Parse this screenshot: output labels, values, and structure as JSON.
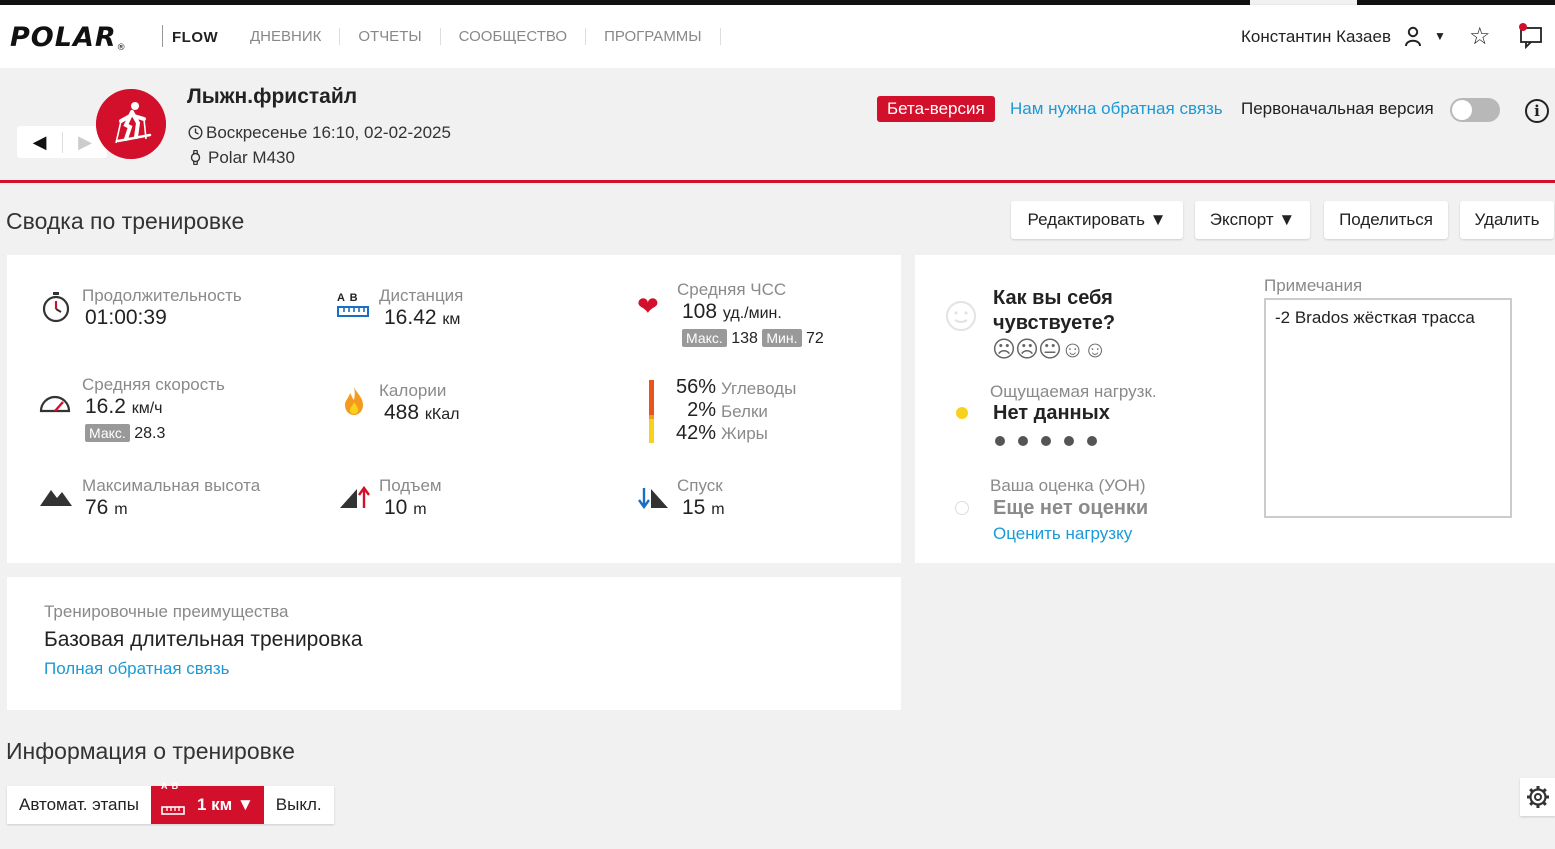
{
  "brand": {
    "logo": "POLAR",
    "logo_mark": "®",
    "product": "FLOW"
  },
  "nav": {
    "items": [
      "ДНЕВНИК",
      "ОТЧЕТЫ",
      "СООБЩЕСТВО",
      "ПРОГРАММЫ"
    ]
  },
  "user": {
    "name": "Константин Казаев"
  },
  "activity": {
    "title": "Лыжн.фристайл",
    "datetime": "Воскресенье 16:10, 02-02-2025",
    "device": "Polar M430"
  },
  "beta": {
    "badge": "Бета-версия",
    "feedback_link": "Нам нужна обратная связь",
    "original_label": "Первоначальная версия"
  },
  "summary": {
    "title": "Сводка по тренировке",
    "buttons": {
      "edit": "Редактировать ▼",
      "export": "Экспорт ▼",
      "share": "Поделиться",
      "delete": "Удалить"
    }
  },
  "stats": {
    "duration": {
      "label": "Продолжительность",
      "value": "01:00:39"
    },
    "distance": {
      "label": "Дистанция",
      "value": "16.42",
      "unit": "км",
      "icon_text": "A  B"
    },
    "avg_hr": {
      "label": "Средняя ЧСС",
      "value": "108",
      "unit": "уд./мин.",
      "max_label": "Макс.",
      "max": "138",
      "min_label": "Мин.",
      "min": "72"
    },
    "avg_speed": {
      "label": "Средняя скорость",
      "value": "16.2",
      "unit": "км/ч",
      "max_label": "Макс.",
      "max": "28.3"
    },
    "calories": {
      "label": "Калории",
      "value": "488",
      "unit": "кКал"
    },
    "macros": [
      {
        "pct": "56%",
        "name": "Углеводы",
        "color": "#e8541c"
      },
      {
        "pct": "2%",
        "name": "Белки",
        "color": "#f39a1f"
      },
      {
        "pct": "42%",
        "name": "Жиры",
        "color": "#f7d21c"
      }
    ],
    "max_alt": {
      "label": "Максимальная высота",
      "value": "76",
      "unit": "m"
    },
    "ascent": {
      "label": "Подъем",
      "value": "10",
      "unit": "m"
    },
    "descent": {
      "label": "Спуск",
      "value": "15",
      "unit": "m"
    }
  },
  "feeling": {
    "question_line1": "Как вы себя",
    "question_line2": "чувствуете?",
    "faces": "☹☹😐☺☺",
    "rpe_label": "Ощущаемая нагрузк.",
    "rpe_value": "Нет данных",
    "rating_label": "Ваша оценка (УОН)",
    "rating_value": "Еще нет оценки",
    "rate_link": "Оценить нагрузку"
  },
  "notes": {
    "label": "Примечания",
    "text": "-2 Brados жёсткая трасса"
  },
  "benefit": {
    "label": "Тренировочные преимущества",
    "value": "Базовая длительная тренировка",
    "link": "Полная обратная связь"
  },
  "info": {
    "title": "Информация о тренировке",
    "auto_laps": "Автомат. этапы",
    "lap_icon_text": "A B",
    "lap_value": "1 км ▼",
    "off": "Выкл."
  },
  "colors": {
    "accent": "#d3102c",
    "link": "#1a9ad6"
  }
}
